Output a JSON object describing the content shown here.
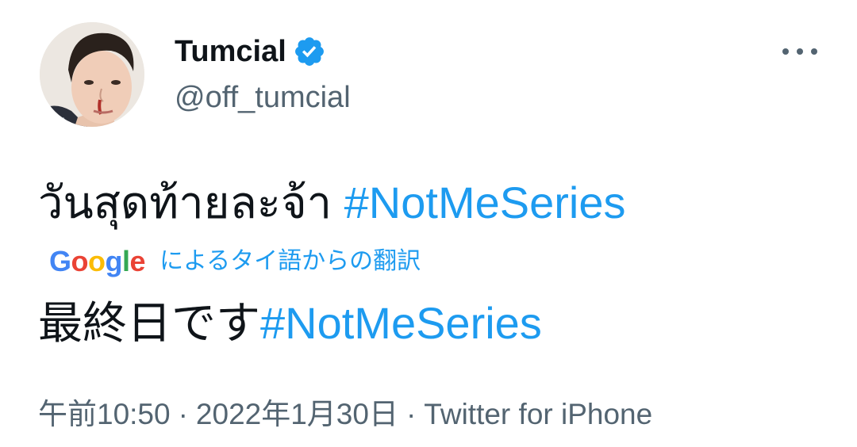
{
  "author": {
    "display_name": "Tumcial",
    "handle": "@off_tumcial",
    "verified": true,
    "verified_icon": "verified-badge-icon"
  },
  "menu": {
    "icon": "more-options-icon"
  },
  "tweet": {
    "text": "วันสุดท้ายละจ้า ",
    "hashtag": "#NotMeSeries"
  },
  "translation": {
    "provider_logo": "Google",
    "label": "によるタイ語からの翻訳",
    "text": "最終日です",
    "hashtag": "#NotMeSeries"
  },
  "meta": {
    "time": "午前10:50",
    "separator": "·",
    "date": "2022年1月30日",
    "source": "Twitter for iPhone"
  },
  "colors": {
    "accent": "#1d9bf0",
    "text_primary": "#0f1419",
    "text_secondary": "#536471"
  }
}
